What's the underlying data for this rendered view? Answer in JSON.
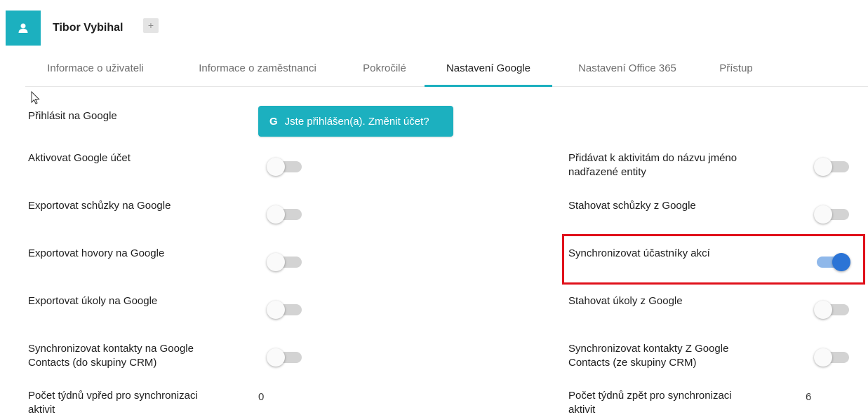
{
  "user": {
    "name": "Tibor Vybihal",
    "add_label": "+"
  },
  "tabs": [
    {
      "label": "Informace o uživateli"
    },
    {
      "label": "Informace o zaměstnanci"
    },
    {
      "label": "Pokročilé"
    },
    {
      "label": "Nastavení Google",
      "active": true
    },
    {
      "label": "Nastavení Office 365"
    },
    {
      "label": "Přístup"
    }
  ],
  "accent_color": "#1cb0bf",
  "google": {
    "login_label": "Přihlásit na Google",
    "button_icon": "G",
    "button_label": "Jste přihlášen(a). Změnit účet?"
  },
  "left_settings": [
    {
      "label": "Aktivovat Google účet",
      "on": false
    },
    {
      "label": "Exportovat schůzky na Google",
      "on": false
    },
    {
      "label": "Exportovat hovory na Google",
      "on": false
    },
    {
      "label": "Exportovat úkoly na Google",
      "on": false
    },
    {
      "label_line1": "Synchronizovat kontakty na Google",
      "label_line2": "Contacts (do skupiny CRM)",
      "on": false
    },
    {
      "label_line1": "Počet týdnů vpřed pro synchronizaci",
      "label_line2": "aktivit",
      "value": "0"
    }
  ],
  "right_settings": [
    {
      "label_line1": "Přidávat k aktivitám do názvu jméno",
      "label_line2": "nadřazené entity",
      "on": false
    },
    {
      "label": "Stahovat schůzky z Google",
      "on": false
    },
    {
      "label": "Synchronizovat účastníky akcí",
      "on": true
    },
    {
      "label": "Stahovat úkoly z Google",
      "on": false
    },
    {
      "label_line1": "Synchronizovat kontakty Z Google",
      "label_line2": "Contacts (ze skupiny CRM)",
      "on": false
    },
    {
      "label_line1": "Počet týdnů zpět pro synchronizaci",
      "label_line2": "aktivit",
      "value": "6"
    }
  ]
}
